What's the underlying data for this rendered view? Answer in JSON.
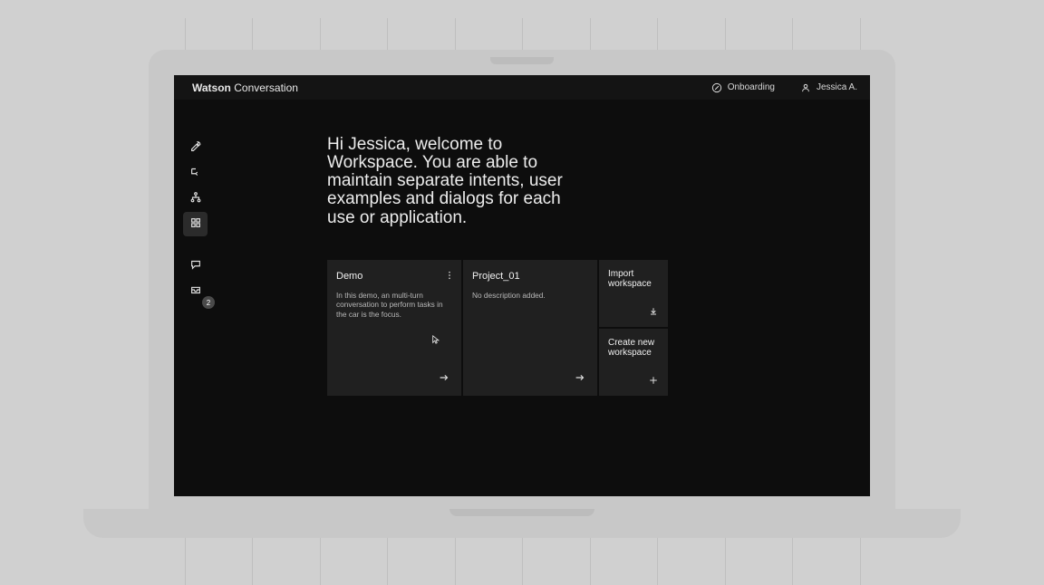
{
  "brand": {
    "bold": "Watson",
    "light": "Conversation"
  },
  "header": {
    "onboarding": "Onboarding",
    "user": "Jessica A."
  },
  "sidebar": {
    "badge_count": "2"
  },
  "welcome": "Hi Jessica, welcome to Workspace. You are able to maintain separate intents, user examples and dialogs for each use or application.",
  "cards": {
    "demo": {
      "title": "Demo",
      "desc": "In this demo, an multi-turn conversation to perform tasks in the car is the focus."
    },
    "project01": {
      "title": "Project_01",
      "desc": "No description added."
    },
    "import": {
      "title": "Import workspace"
    },
    "create": {
      "title": "Create new workspace"
    }
  }
}
